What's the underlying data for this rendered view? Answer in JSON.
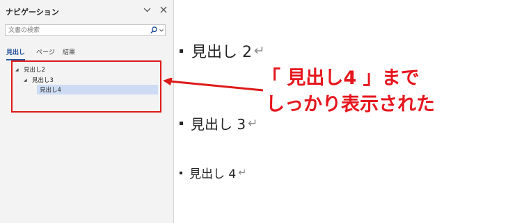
{
  "navigation": {
    "title": "ナビゲーション",
    "dropdown_icon": "chevron-down-icon",
    "close_icon": "close-icon",
    "search": {
      "placeholder": "文書の検索",
      "value": ""
    },
    "tabs": [
      {
        "label": "見出し",
        "active": true
      },
      {
        "label": "ページ",
        "active": false
      },
      {
        "label": "結果",
        "active": false
      }
    ],
    "tree": [
      {
        "label": "見出し2",
        "level": 2,
        "expanded": true
      },
      {
        "label": "見出し3",
        "level": 3,
        "expanded": true
      },
      {
        "label": "見出し4",
        "level": 4,
        "selected": true
      }
    ]
  },
  "document": {
    "headings": [
      {
        "text": "見出し 2"
      },
      {
        "text": "見出し 3"
      },
      {
        "text": "見出し 4"
      }
    ],
    "paragraph_mark": "↵"
  },
  "annotation": {
    "line1": "「 見出し4 」まで",
    "line2": "しっかり表示された",
    "color": "#e6161e"
  },
  "colors": {
    "highlight_frame": "#dd1a1a",
    "selected_row": "#cddcf4",
    "active_tab": "#2b579a"
  }
}
